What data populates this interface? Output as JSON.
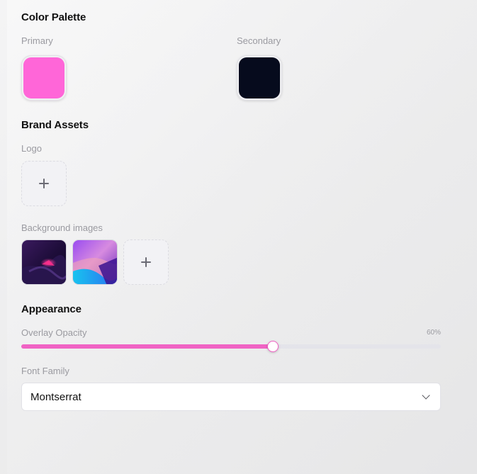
{
  "color_palette": {
    "title": "Color Palette",
    "primary": {
      "label": "Primary",
      "color": "#ff66d8"
    },
    "secondary": {
      "label": "Secondary",
      "color": "#060b1d"
    }
  },
  "brand_assets": {
    "title": "Brand Assets",
    "logo_label": "Logo",
    "background_images_label": "Background images",
    "background_images": [
      {
        "icon": "abstract-dark-pink-wave-image"
      },
      {
        "icon": "abstract-purple-cyan-landscape-image"
      }
    ]
  },
  "appearance": {
    "title": "Appearance",
    "overlay_opacity": {
      "label": "Overlay Opacity",
      "value_text": "60%",
      "value": 0.6
    },
    "font_family": {
      "label": "Font Family",
      "selected": "Montserrat"
    }
  },
  "colors": {
    "accent": "#f063c4",
    "track": "#e4e4ea"
  }
}
